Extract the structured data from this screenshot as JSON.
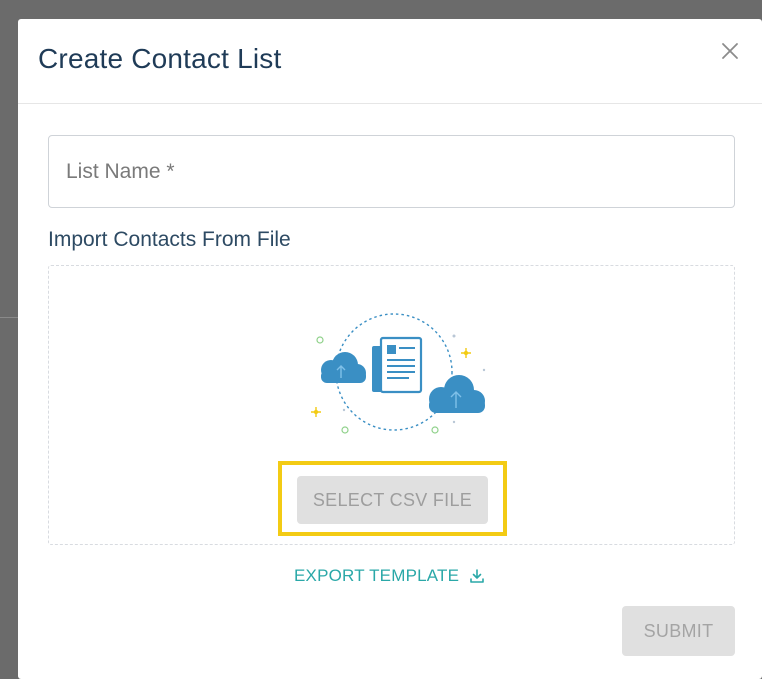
{
  "modal": {
    "title": "Create Contact List",
    "close_icon": "close-icon"
  },
  "form": {
    "list_name_placeholder": "List Name *",
    "list_name_value": "",
    "import_label": "Import Contacts From File"
  },
  "dropzone": {
    "illustration_icon": "cloud-upload-document-icon",
    "select_button_label": "SELECT CSV FILE"
  },
  "export": {
    "label": "EXPORT TEMPLATE",
    "icon": "download-icon"
  },
  "footer": {
    "submit_label": "SUBMIT"
  },
  "colors": {
    "title": "#1f3b57",
    "accent_teal": "#2aa8a8",
    "cloud_blue": "#3a8fc4",
    "highlight_yellow": "#f3cb14",
    "disabled_button_bg": "#e0e0e0"
  }
}
